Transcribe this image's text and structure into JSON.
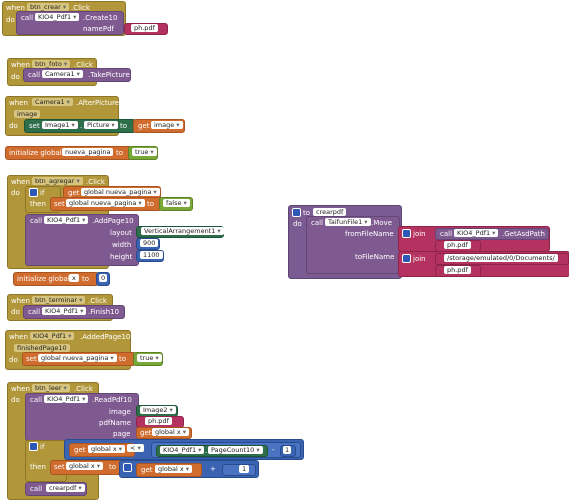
{
  "kw": {
    "when": "when",
    "do": "do",
    "call": "call",
    "set": "set",
    "get": "get",
    "to": "to",
    "if": "if",
    "then": "then",
    "init": "initialize global",
    "join": "join"
  },
  "b1": {
    "comp": "btn_crear",
    "ev": ".Click",
    "target": "KIO4_Pdf1",
    "method": ".Create10",
    "param": "namePdf",
    "value": "ph.pdf"
  },
  "b2": {
    "comp": "btn_foto",
    "ev": ".Click",
    "target": "Camera1",
    "method": ".TakePicture"
  },
  "b3": {
    "comp": "Camera1",
    "ev": ".AfterPicture",
    "param": "image",
    "setcomp": "Image1",
    "prop": "Picture",
    "getvar": "image"
  },
  "g1": {
    "name": "nueva_pagina",
    "value": "true"
  },
  "b4": {
    "comp": "btn_agregar",
    "ev": ".Click",
    "getvar": "global nueva_pagina",
    "setvar": "global nueva_pagina",
    "val": "false",
    "target": "KIO4_Pdf1",
    "method": ".AddPage10",
    "p1": "layout",
    "p1v": "VerticalArrangement1",
    "p2": "width",
    "p2v": "900",
    "p3": "height",
    "p3v": "1100"
  },
  "g2": {
    "name": "x",
    "value": "0"
  },
  "b5": {
    "comp": "btn_terminar",
    "ev": ".Click",
    "target": "KIO4_Pdf1",
    "method": ".Finish10"
  },
  "b6": {
    "comp": "KIO4_Pdf1",
    "ev": ".AddedPage10",
    "param": "finishedPage10",
    "setvar": "global nueva_pagina",
    "val": "true"
  },
  "b7": {
    "comp": "btn_leer",
    "ev": ".Click",
    "target": "KIO4_Pdf1",
    "method": ".ReadPdf10",
    "p1": "image",
    "p1v": "Image2",
    "p2": "pdfName",
    "p2v": "ph.pdf",
    "p3": "page",
    "p3v": "global x",
    "ifvar": "global x",
    "op": "<",
    "ct": "KIO4_Pdf1",
    "cprop": "PageCount10",
    "minus": "-",
    "one": "1",
    "setvar": "global x",
    "plus": "+",
    "one2": "1",
    "proc": "crearpdf"
  },
  "p1": {
    "to": "to",
    "name": "crearpdf",
    "comp": "TaifunFile1",
    "method": ".Move",
    "from": "fromFileName",
    "tofile": "toFileName",
    "join": "join",
    "ct": "KIO4_Pdf1",
    "cmeth": ".GetAsdPath",
    "t1": "ph.pdf",
    "t2": "/storage/emulated/0/Documents/",
    "t3": "ph.pdf"
  }
}
